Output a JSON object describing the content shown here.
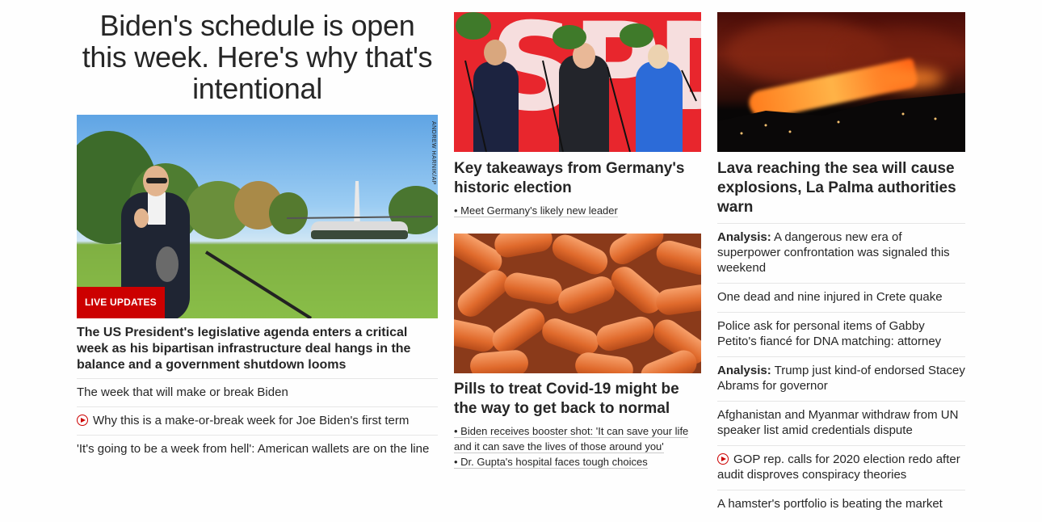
{
  "main_story": {
    "headline": "Biden's schedule is open this week. Here's why that's intentional",
    "photo_credit": "ANDREW HARNIK/AP",
    "badge": "LIVE UPDATES",
    "summary": "The US President's legislative agenda enters a critical week as his bipartisan infrastructure deal hangs in the balance and a government shutdown looms",
    "links": [
      {
        "text": "The week that will make or break Biden",
        "video": false
      },
      {
        "text": "Why this is a make-or-break week for Joe Biden's first term",
        "video": true
      },
      {
        "text": "'It's going to be a week from hell': American wallets are on the line",
        "video": false
      }
    ]
  },
  "germany_story": {
    "image_text": "SPD",
    "title": "Key takeaways from Germany's historic election",
    "links": [
      "• Meet Germany's likely new leader"
    ]
  },
  "covid_story": {
    "title": "Pills to treat Covid-19 might be the way to get back to normal",
    "links": [
      "• Biden receives booster shot: 'It can save your life and it can save the lives of those around you'",
      "• Dr. Gupta's hospital faces tough choices"
    ]
  },
  "lava_story": {
    "title": "Lava reaching the sea will cause explosions, La Palma authorities warn",
    "links": [
      {
        "prefix": "Analysis:",
        "text": "A dangerous new era of superpower confrontation was signaled this weekend",
        "video": false
      },
      {
        "prefix": "",
        "text": "One dead and nine injured in Crete quake",
        "video": false
      },
      {
        "prefix": "",
        "text": "Police ask for personal items of Gabby Petito's fiancé for DNA matching: attorney",
        "video": false
      },
      {
        "prefix": "Analysis:",
        "text": "Trump just kind-of endorsed Stacey Abrams for governor",
        "video": false
      },
      {
        "prefix": "",
        "text": "Afghanistan and Myanmar withdraw from UN speaker list amid credentials dispute",
        "video": false
      },
      {
        "prefix": "",
        "text": "GOP rep. calls for 2020 election redo after audit disproves conspiracy theories",
        "video": true
      },
      {
        "prefix": "",
        "text": "A hamster's portfolio is beating the market",
        "video": false
      }
    ]
  },
  "colors": {
    "accent": "#cc0000",
    "text": "#262626",
    "divider": "#e6e6e6"
  }
}
